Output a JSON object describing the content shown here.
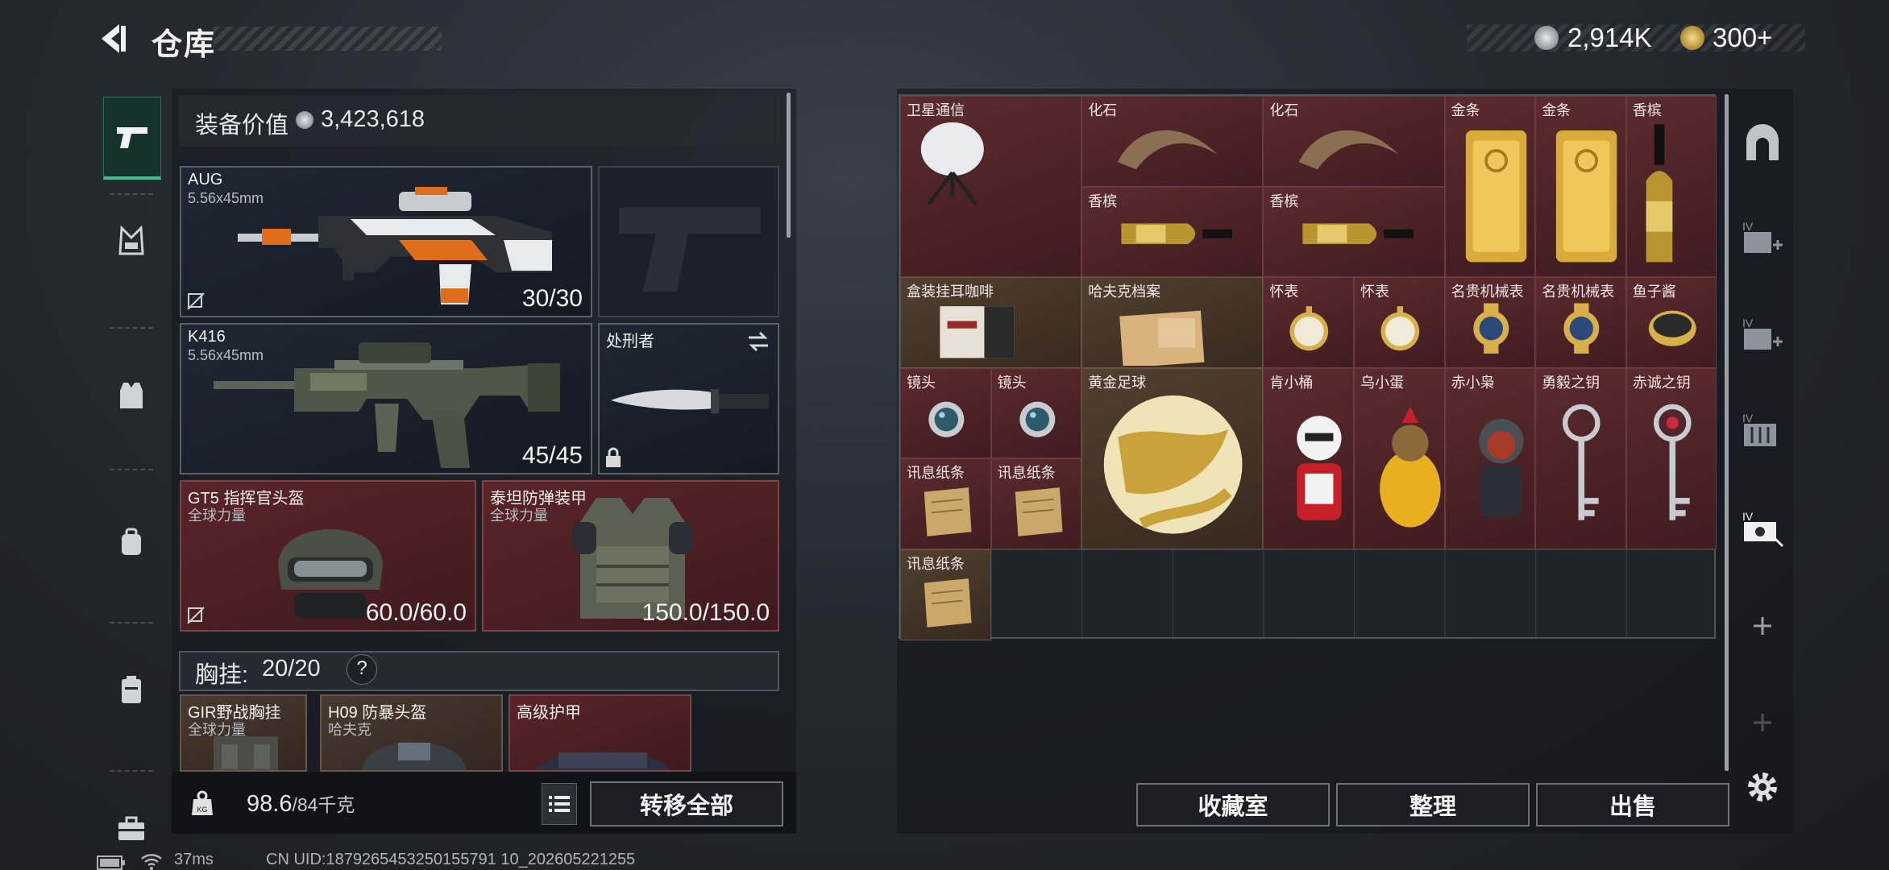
{
  "header": {
    "title": "仓库"
  },
  "currency": {
    "silver": "2,914K",
    "gold": "300+"
  },
  "left_panel": {
    "equipment_value_label": "装备价值",
    "equipment_value": "3,423,618",
    "primary1": {
      "name": "AUG",
      "caliber": "5.56x45mm",
      "ammo": "30/30"
    },
    "primary2": {
      "name": "K416",
      "caliber": "5.56x45mm",
      "ammo": "45/45"
    },
    "melee": {
      "name": "处刑者"
    },
    "helmet": {
      "name": "GT5 指挥官头盔",
      "sub": "全球力量",
      "durability": "60.0/60.0"
    },
    "armor": {
      "name": "泰坦防弹装甲",
      "sub": "全球力量",
      "durability": "150.0/150.0"
    },
    "chest_rig": {
      "label": "胸挂:",
      "count": "20/20",
      "help": "?"
    },
    "chest_items": [
      {
        "name": "GIR野战胸挂",
        "sub": "全球力量"
      },
      {
        "name": "H09 防暴头盔",
        "sub": "哈夫克"
      },
      {
        "name": "高级护甲",
        "sub": ""
      }
    ],
    "weight": "98.6",
    "weight_max": "/84千克",
    "transfer_all": "转移全部"
  },
  "stash": {
    "items": [
      {
        "name": "卫星通信",
        "tint": "r",
        "c": 0,
        "r": 0,
        "w": 2,
        "h": 2,
        "icon": "satellite-dish"
      },
      {
        "name": "化石",
        "tint": "r",
        "c": 2,
        "r": 0,
        "w": 2,
        "h": 1,
        "icon": "fossil-claw"
      },
      {
        "name": "化石",
        "tint": "r",
        "c": 4,
        "r": 0,
        "w": 2,
        "h": 1,
        "icon": "fossil-claw"
      },
      {
        "name": "金条",
        "tint": "r",
        "c": 6,
        "r": 0,
        "w": 1,
        "h": 2,
        "icon": "gold-bar"
      },
      {
        "name": "金条",
        "tint": "r",
        "c": 7,
        "r": 0,
        "w": 1,
        "h": 2,
        "icon": "gold-bar"
      },
      {
        "name": "香槟",
        "tint": "r",
        "c": 8,
        "r": 0,
        "w": 1,
        "h": 2,
        "icon": "champagne-upright"
      },
      {
        "name": "香槟",
        "tint": "r",
        "c": 2,
        "r": 1,
        "w": 2,
        "h": 1,
        "icon": "champagne-lying"
      },
      {
        "name": "香槟",
        "tint": "r",
        "c": 4,
        "r": 1,
        "w": 2,
        "h": 1,
        "icon": "champagne-lying"
      },
      {
        "name": "盒装挂耳咖啡",
        "tint": "b",
        "c": 0,
        "r": 2,
        "w": 2,
        "h": 1,
        "icon": "coffee-box"
      },
      {
        "name": "哈夫克档案",
        "tint": "b",
        "c": 2,
        "r": 2,
        "w": 2,
        "h": 1,
        "icon": "file-folder"
      },
      {
        "name": "怀表",
        "tint": "r",
        "c": 4,
        "r": 2,
        "w": 1,
        "h": 1,
        "icon": "pocket-watch"
      },
      {
        "name": "怀表",
        "tint": "r",
        "c": 5,
        "r": 2,
        "w": 1,
        "h": 1,
        "icon": "pocket-watch"
      },
      {
        "name": "名贵机械表",
        "tint": "r",
        "c": 6,
        "r": 2,
        "w": 1,
        "h": 1,
        "icon": "wrist-watch"
      },
      {
        "name": "名贵机械表",
        "tint": "r",
        "c": 7,
        "r": 2,
        "w": 1,
        "h": 1,
        "icon": "wrist-watch"
      },
      {
        "name": "鱼子酱",
        "tint": "r",
        "c": 8,
        "r": 2,
        "w": 1,
        "h": 1,
        "icon": "caviar-tin"
      },
      {
        "name": "镜头",
        "tint": "r",
        "c": 0,
        "r": 3,
        "w": 1,
        "h": 1,
        "icon": "camera-lens"
      },
      {
        "name": "镜头",
        "tint": "r",
        "c": 1,
        "r": 3,
        "w": 1,
        "h": 1,
        "icon": "camera-lens"
      },
      {
        "name": "黄金足球",
        "tint": "b",
        "c": 2,
        "r": 3,
        "w": 2,
        "h": 2,
        "icon": "gold-football"
      },
      {
        "name": "肯小桶",
        "tint": "r",
        "c": 4,
        "r": 3,
        "w": 1,
        "h": 2,
        "icon": "figure-colonel"
      },
      {
        "name": "乌小蛋",
        "tint": "r",
        "c": 5,
        "r": 3,
        "w": 1,
        "h": 2,
        "icon": "figure-egg"
      },
      {
        "name": "赤小枭",
        "tint": "r",
        "c": 6,
        "r": 3,
        "w": 1,
        "h": 2,
        "icon": "figure-hood"
      },
      {
        "name": "勇毅之钥",
        "tint": "r",
        "c": 7,
        "r": 3,
        "w": 1,
        "h": 2,
        "icon": "ornate-key"
      },
      {
        "name": "赤诚之钥",
        "tint": "r",
        "c": 8,
        "r": 3,
        "w": 1,
        "h": 2,
        "icon": "ornate-key-red"
      },
      {
        "name": "讯息纸条",
        "tint": "r",
        "c": 0,
        "r": 4,
        "w": 1,
        "h": 1,
        "icon": "paper-note"
      },
      {
        "name": "讯息纸条",
        "tint": "r",
        "c": 1,
        "r": 4,
        "w": 1,
        "h": 1,
        "icon": "paper-note"
      },
      {
        "name": "讯息纸条",
        "tint": "b",
        "c": 0,
        "r": 5,
        "w": 1,
        "h": 1,
        "icon": "paper-note"
      }
    ],
    "buttons": {
      "collection": "收藏室",
      "sort": "整理",
      "sell": "出售"
    }
  },
  "status_bar": {
    "ping": "37ms",
    "uid": "CN UID:1879265453250155791 10_202605221255"
  },
  "colors": {
    "accent_green": "#3fbf8e",
    "red_slot": "#5a2428",
    "gold": "#d4b25a"
  }
}
